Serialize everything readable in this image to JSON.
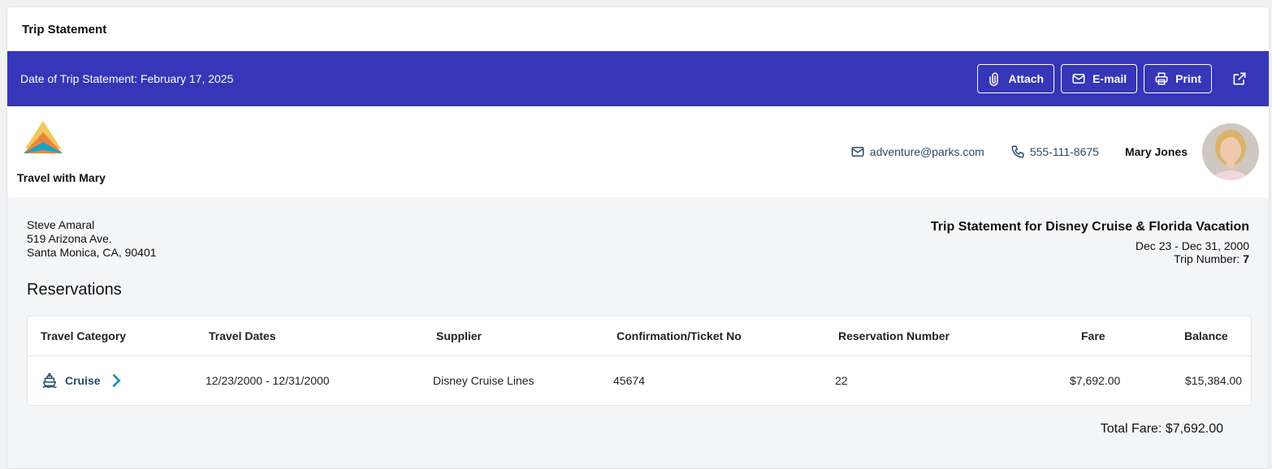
{
  "panel": {
    "title": "Trip Statement"
  },
  "bar": {
    "date_label": "Date of Trip Statement:",
    "date_value": "February 17, 2025",
    "attach_label": "Attach",
    "email_label": "E-mail",
    "print_label": "Print"
  },
  "agent": {
    "agency_name": "Travel with Mary",
    "email": "adventure@parks.com",
    "phone": "555-111-8675",
    "name": "Mary Jones"
  },
  "client": {
    "name": "Steve Amaral",
    "address1": "519 Arizona Ave.",
    "address2": "Santa Monica, CA, 90401"
  },
  "trip": {
    "title": "Trip Statement for Disney Cruise & Florida Vacation",
    "dates": "Dec 23 - Dec 31, 2000",
    "number_label": "Trip Number:",
    "number_value": "7"
  },
  "reservations": {
    "title": "Reservations",
    "columns": [
      "Travel Category",
      "Travel Dates",
      "Supplier",
      "Confirmation/Ticket No",
      "Reservation Number",
      "Fare",
      "Balance"
    ],
    "rows": [
      {
        "category": "Cruise",
        "dates": "12/23/2000 - 12/31/2000",
        "supplier": "Disney Cruise Lines",
        "confirmation": "45674",
        "reservation_number": "22",
        "fare": "$7,692.00",
        "balance": "$15,384.00"
      }
    ],
    "total_fare": "Total Fare: $7,692.00"
  },
  "colors": {
    "bar": "#3536b8",
    "link": "#234b6b"
  },
  "icons": {
    "attach": "paperclip-icon",
    "email": "envelope-icon",
    "print": "printer-icon",
    "open": "external-link-icon",
    "phone": "phone-icon",
    "cruise": "ship-icon",
    "chevron": "chevron-right-icon"
  }
}
